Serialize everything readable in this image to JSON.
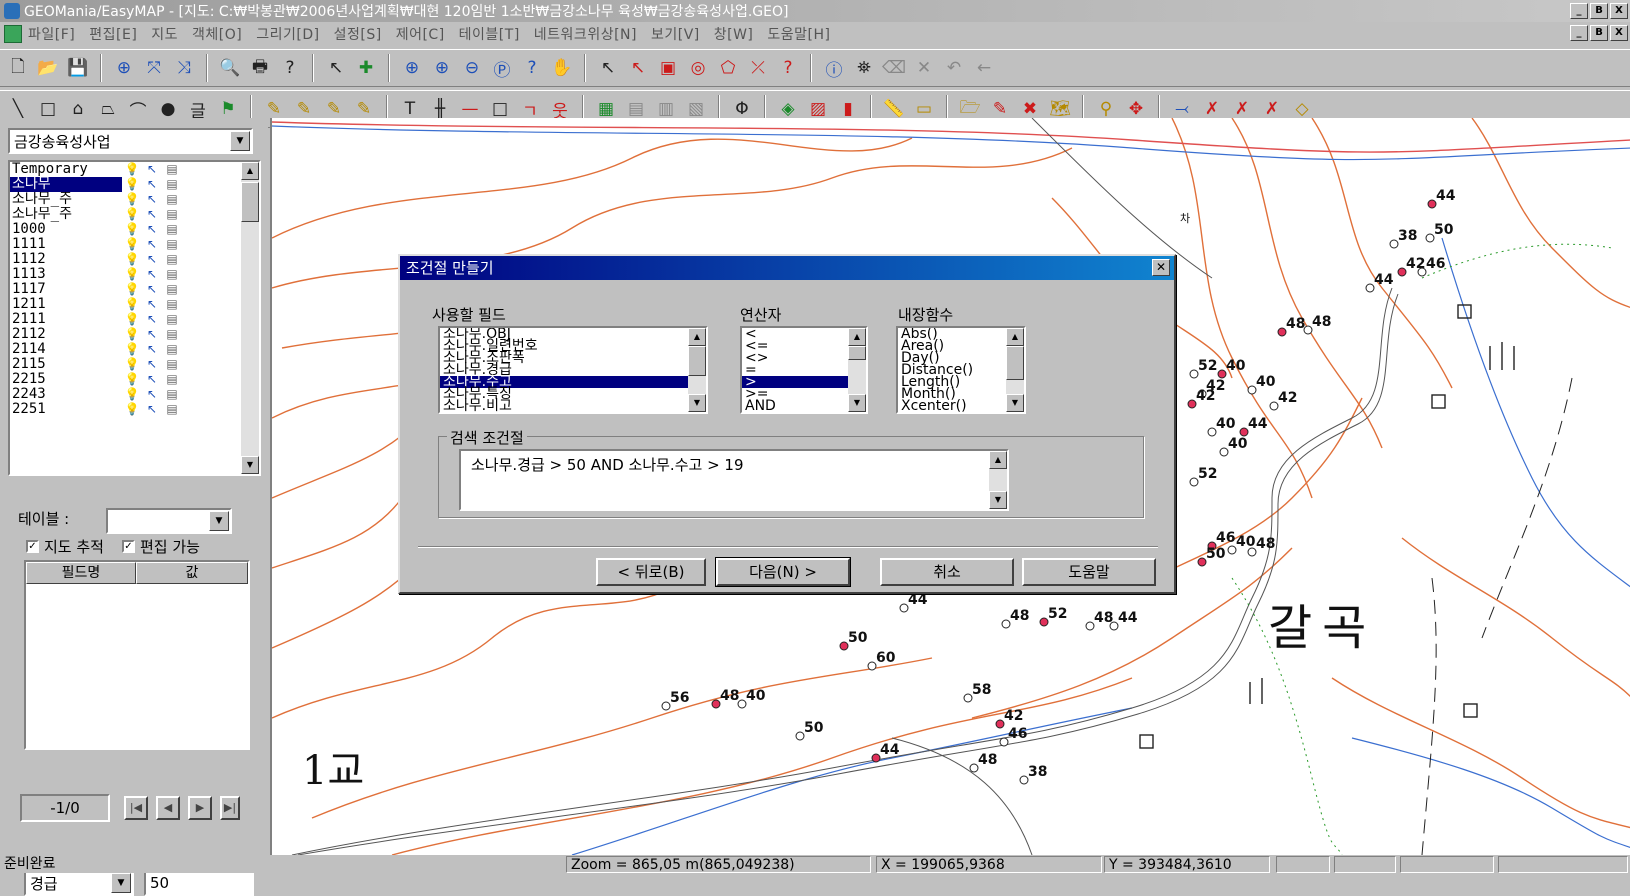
{
  "window": {
    "title": "GEOMania/EasyMAP - [지도: C:₩박봉관₩2006년사업계획₩대현 120임반 1소반₩금강소나무 육성₩금강송육성사업.GEO]",
    "controls": [
      "_",
      "B",
      "X"
    ]
  },
  "menu": [
    "파일[F]",
    "편집[E]",
    "지도",
    "객체[O]",
    "그리기[D]",
    "설정[S]",
    "제어[C]",
    "테이블[T]",
    "네트워크위상[N]",
    "보기[V]",
    "창[W]",
    "도움말[H]"
  ],
  "left": {
    "map_combo": "금강송육성사업",
    "layers": [
      {
        "name": "Temporary",
        "selected": false
      },
      {
        "name": "소나무",
        "selected": true
      },
      {
        "name": "소나무_주",
        "selected": false
      },
      {
        "name": "소나무_주",
        "selected": false
      },
      {
        "name": "1000",
        "selected": false
      },
      {
        "name": "1111",
        "selected": false
      },
      {
        "name": "1112",
        "selected": false
      },
      {
        "name": "1113",
        "selected": false
      },
      {
        "name": "1117",
        "selected": false
      },
      {
        "name": "1211",
        "selected": false
      },
      {
        "name": "2111",
        "selected": false
      },
      {
        "name": "2112",
        "selected": false
      },
      {
        "name": "2114",
        "selected": false
      },
      {
        "name": "2115",
        "selected": false
      },
      {
        "name": "2215",
        "selected": false
      },
      {
        "name": "2243",
        "selected": false
      },
      {
        "name": "2251",
        "selected": false
      }
    ],
    "table_label": "테이블 :",
    "table_value": "",
    "map_track_label": "지도 추적",
    "editable_label": "편집 가능",
    "map_track_checked": true,
    "editable_checked": true,
    "grid_headers": [
      "필드명",
      "값"
    ],
    "field_combo": "경급",
    "field_value": "50",
    "record_counter": "-1/0"
  },
  "map": {
    "place_name": "갈곡",
    "bridge_label": "1교",
    "small_mark": "차",
    "point_labels": [
      "44",
      "38",
      "50",
      "42",
      "46",
      "44",
      "48",
      "48",
      "52",
      "40",
      "42",
      "40",
      "42",
      "42",
      "40",
      "44",
      "40",
      "52",
      "46",
      "40",
      "48",
      "50",
      "44",
      "48",
      "50",
      "60",
      "56",
      "48",
      "40",
      "50",
      "44",
      "48",
      "38",
      "52",
      "48",
      "44",
      "42",
      "46",
      "58"
    ]
  },
  "dialog": {
    "title": "조건절 만들기",
    "fields_label": "사용할 필드",
    "operators_label": "연산자",
    "functions_label": "내장함수",
    "fields": [
      "소나무.OBJ",
      "소나무.일련번호",
      "소나무.조판폭",
      "소나무.경급",
      "소나무.수고",
      "소나무.특징",
      "소나무.비고"
    ],
    "fields_selected": 4,
    "operators": [
      "<",
      "<=",
      "<>",
      "=",
      ">",
      ">=",
      "AND"
    ],
    "operators_selected": 4,
    "functions": [
      "Abs()",
      "Area()",
      "Day()",
      "Distance()",
      "Length()",
      "Month()",
      "Xcenter()"
    ],
    "condition_group_label": "검색 조건절",
    "condition_text": "소나무.경급  > 50 AND  소나무.수고  > 19",
    "buttons": {
      "back": "< 뒤로(B)",
      "next": "다음(N) >",
      "cancel": "취소",
      "help": "도움말"
    }
  },
  "status": {
    "ready": "준비완료",
    "zoom": "Zoom = 865,05   m(865,049238)",
    "x": "X = 199065,9368",
    "y": "Y = 393484,3610"
  },
  "colors": {
    "selection": "#000080",
    "dialog_title_start": "#000080",
    "contour": "#e0703a",
    "road_blue": "#3b6fd0",
    "marker_red": "#e0305a"
  }
}
